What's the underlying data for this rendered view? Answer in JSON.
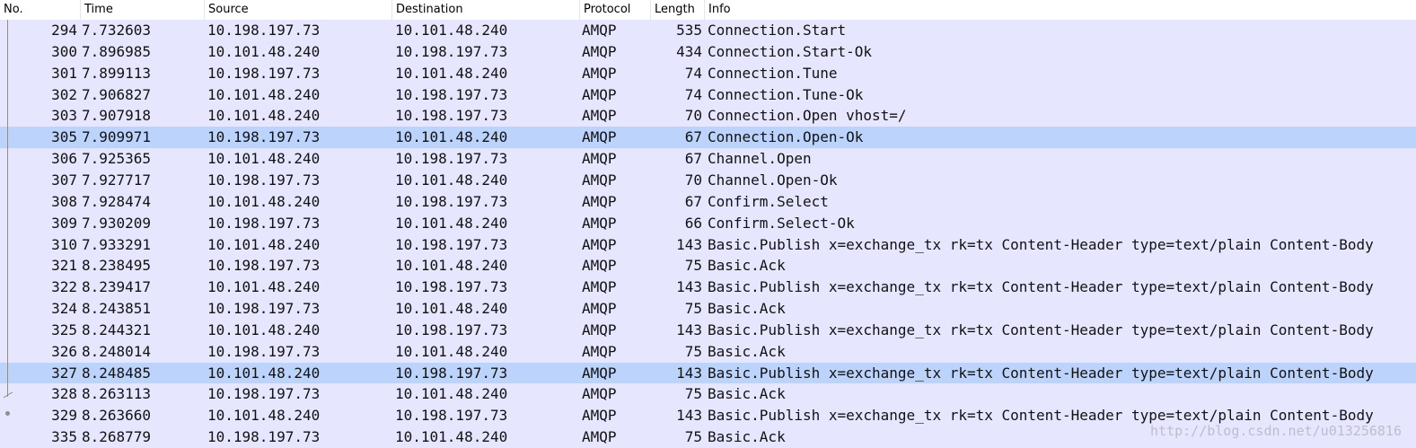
{
  "columns": {
    "no": "No.",
    "time": "Time",
    "source": "Source",
    "destination": "Destination",
    "protocol": "Protocol",
    "length": "Length",
    "info": "Info"
  },
  "packets": [
    {
      "no": "294",
      "time": "7.732603",
      "source": "10.198.197.73",
      "destination": "10.101.48.240",
      "protocol": "AMQP",
      "length": "535",
      "info": "Connection.Start",
      "selected": false
    },
    {
      "no": "300",
      "time": "7.896985",
      "source": "10.101.48.240",
      "destination": "10.198.197.73",
      "protocol": "AMQP",
      "length": "434",
      "info": "Connection.Start-Ok",
      "selected": false
    },
    {
      "no": "301",
      "time": "7.899113",
      "source": "10.198.197.73",
      "destination": "10.101.48.240",
      "protocol": "AMQP",
      "length": "74",
      "info": "Connection.Tune",
      "selected": false
    },
    {
      "no": "302",
      "time": "7.906827",
      "source": "10.101.48.240",
      "destination": "10.198.197.73",
      "protocol": "AMQP",
      "length": "74",
      "info": "Connection.Tune-Ok",
      "selected": false
    },
    {
      "no": "303",
      "time": "7.907918",
      "source": "10.101.48.240",
      "destination": "10.198.197.73",
      "protocol": "AMQP",
      "length": "70",
      "info": "Connection.Open vhost=/",
      "selected": false
    },
    {
      "no": "305",
      "time": "7.909971",
      "source": "10.198.197.73",
      "destination": "10.101.48.240",
      "protocol": "AMQP",
      "length": "67",
      "info": "Connection.Open-Ok",
      "selected": true
    },
    {
      "no": "306",
      "time": "7.925365",
      "source": "10.101.48.240",
      "destination": "10.198.197.73",
      "protocol": "AMQP",
      "length": "67",
      "info": "Channel.Open",
      "selected": false
    },
    {
      "no": "307",
      "time": "7.927717",
      "source": "10.198.197.73",
      "destination": "10.101.48.240",
      "protocol": "AMQP",
      "length": "70",
      "info": "Channel.Open-Ok",
      "selected": false
    },
    {
      "no": "308",
      "time": "7.928474",
      "source": "10.101.48.240",
      "destination": "10.198.197.73",
      "protocol": "AMQP",
      "length": "67",
      "info": "Confirm.Select",
      "selected": false
    },
    {
      "no": "309",
      "time": "7.930209",
      "source": "10.198.197.73",
      "destination": "10.101.48.240",
      "protocol": "AMQP",
      "length": "66",
      "info": "Confirm.Select-Ok",
      "selected": false
    },
    {
      "no": "310",
      "time": "7.933291",
      "source": "10.101.48.240",
      "destination": "10.198.197.73",
      "protocol": "AMQP",
      "length": "143",
      "info": "Basic.Publish x=exchange_tx rk=tx Content-Header type=text/plain Content-Body",
      "selected": false
    },
    {
      "no": "321",
      "time": "8.238495",
      "source": "10.198.197.73",
      "destination": "10.101.48.240",
      "protocol": "AMQP",
      "length": "75",
      "info": "Basic.Ack",
      "selected": false
    },
    {
      "no": "322",
      "time": "8.239417",
      "source": "10.101.48.240",
      "destination": "10.198.197.73",
      "protocol": "AMQP",
      "length": "143",
      "info": "Basic.Publish x=exchange_tx rk=tx Content-Header type=text/plain Content-Body",
      "selected": false
    },
    {
      "no": "324",
      "time": "8.243851",
      "source": "10.198.197.73",
      "destination": "10.101.48.240",
      "protocol": "AMQP",
      "length": "75",
      "info": "Basic.Ack",
      "selected": false
    },
    {
      "no": "325",
      "time": "8.244321",
      "source": "10.101.48.240",
      "destination": "10.198.197.73",
      "protocol": "AMQP",
      "length": "143",
      "info": "Basic.Publish x=exchange_tx rk=tx Content-Header type=text/plain Content-Body",
      "selected": false
    },
    {
      "no": "326",
      "time": "8.248014",
      "source": "10.198.197.73",
      "destination": "10.101.48.240",
      "protocol": "AMQP",
      "length": "75",
      "info": "Basic.Ack",
      "selected": false
    },
    {
      "no": "327",
      "time": "8.248485",
      "source": "10.101.48.240",
      "destination": "10.198.197.73",
      "protocol": "AMQP",
      "length": "143",
      "info": "Basic.Publish x=exchange_tx rk=tx Content-Header type=text/plain Content-Body",
      "selected": true
    },
    {
      "no": "328",
      "time": "8.263113",
      "source": "10.198.197.73",
      "destination": "10.101.48.240",
      "protocol": "AMQP",
      "length": "75",
      "info": "Basic.Ack",
      "selected": false
    },
    {
      "no": "329",
      "time": "8.263660",
      "source": "10.101.48.240",
      "destination": "10.198.197.73",
      "protocol": "AMQP",
      "length": "143",
      "info": "Basic.Publish x=exchange_tx rk=tx Content-Header type=text/plain Content-Body",
      "selected": false
    },
    {
      "no": "335",
      "time": "8.268779",
      "source": "10.198.197.73",
      "destination": "10.101.48.240",
      "protocol": "AMQP",
      "length": "75",
      "info": "Basic.Ack",
      "selected": false
    }
  ],
  "watermark": "http://blog.csdn.net/u013256816",
  "colors": {
    "row_background": "#e7e6ff",
    "selected_row_background": "#bcd4fc",
    "text": "#121212"
  }
}
